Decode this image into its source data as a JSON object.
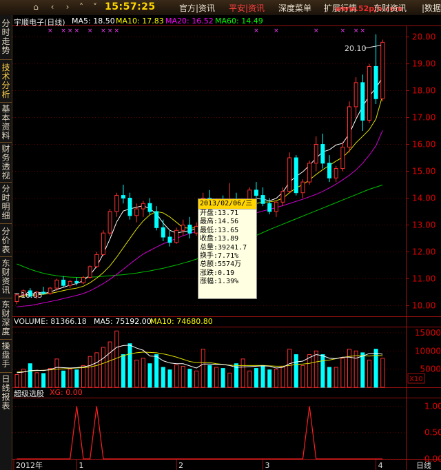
{
  "toolbar": {
    "home_icon": "home-icon",
    "clock": "15:57:25",
    "menus": [
      {
        "label": "官方|资讯",
        "active": false
      },
      {
        "label": "平安|资讯",
        "active": true
      },
      {
        "label": "深度菜单",
        "active": false
      },
      {
        "label": "扩展行情",
        "active": false
      },
      {
        "label": "东财资讯",
        "active": false
      },
      {
        "label": "|数据",
        "active": false
      }
    ],
    "watermark": "www.52pjb.com"
  },
  "sidebar": {
    "tabs": [
      {
        "label": "分时走势",
        "active": false
      },
      {
        "label": "技术分析",
        "active": true
      },
      {
        "label": "基本资料",
        "active": false
      },
      {
        "label": "财务透视",
        "active": false
      },
      {
        "label": "分时明细",
        "active": false
      },
      {
        "label": "分价表",
        "active": false
      },
      {
        "label": "东财资讯",
        "active": false
      },
      {
        "label": "东财深度",
        "active": false
      },
      {
        "label": "操盘手",
        "active": false
      },
      {
        "label": "日线报表",
        "active": false
      }
    ]
  },
  "kline_header": {
    "stock": "宇顺电子(日线)",
    "ma5": "MA5: 18.50",
    "ma10": "MA10: 17.83",
    "ma20": "MA20: 16.52",
    "ma60": "MA60: 14.49",
    "colors": {
      "ma5": "#ffffff",
      "ma10": "#ffff00",
      "ma20": "#ff00ff",
      "ma60": "#00ff00"
    }
  },
  "volume_header": {
    "volume": "VOLUME: 81366.18",
    "ma5": "MA5: 75192.00",
    "ma10": "MA10: 74680.80"
  },
  "indicator_header": {
    "name": "超级选股",
    "xg": "XG: 0.00"
  },
  "annotations": {
    "high": "20.10",
    "low": "10.05"
  },
  "axis": {
    "price_ticks": [
      "20.00",
      "19.00",
      "18.00",
      "17.00",
      "16.00",
      "15.00",
      "14.00",
      "13.00",
      "12.00",
      "11.00",
      "10.00"
    ],
    "volume_ticks": [
      "15000",
      "10000",
      "5000"
    ],
    "volume_unit": "X10",
    "indicator_ticks": [
      "1.00",
      "0.50",
      "0.00"
    ],
    "date_labels": [
      "2012年",
      "1",
      "2",
      "3",
      "4"
    ],
    "period": "日线"
  },
  "tooltip": {
    "date": "2013/02/06/三",
    "rows": [
      "开盘:13.71",
      "最高:14.56",
      "最低:13.65",
      "收盘:13.89",
      "总量:39241.7",
      "换手:7.71%",
      "总额:5574万",
      "涨跌:0.19",
      "涨幅:1.39%"
    ]
  },
  "chart_data": {
    "type": "candlestick",
    "price_range": [
      9.6,
      20.4
    ],
    "volume_range": [
      0,
      16500
    ],
    "indicator_range": [
      0,
      1.15
    ],
    "candles": [
      [
        10.15,
        10.45,
        10.05,
        10.4
      ],
      [
        10.4,
        10.6,
        10.3,
        10.55
      ],
      [
        10.55,
        10.65,
        10.3,
        10.35
      ],
      [
        10.35,
        10.55,
        10.25,
        10.5
      ],
      [
        10.5,
        10.7,
        10.4,
        10.45
      ],
      [
        10.45,
        10.7,
        10.4,
        10.65
      ],
      [
        10.65,
        11.0,
        10.55,
        10.95
      ],
      [
        10.95,
        11.1,
        10.7,
        10.75
      ],
      [
        10.75,
        10.95,
        10.65,
        10.9
      ],
      [
        10.9,
        11.05,
        10.75,
        10.85
      ],
      [
        10.85,
        11.1,
        10.8,
        11.05
      ],
      [
        11.05,
        11.5,
        11.0,
        11.45
      ],
      [
        11.45,
        12.0,
        11.4,
        11.9
      ],
      [
        11.9,
        12.8,
        11.85,
        12.7
      ],
      [
        12.7,
        13.6,
        12.6,
        13.5
      ],
      [
        13.5,
        14.2,
        13.3,
        14.1
      ],
      [
        14.1,
        14.5,
        13.8,
        14.0
      ],
      [
        14.0,
        14.2,
        13.2,
        13.35
      ],
      [
        13.35,
        13.8,
        13.1,
        13.6
      ],
      [
        13.6,
        13.9,
        13.3,
        13.8
      ],
      [
        13.8,
        14.0,
        13.4,
        13.5
      ],
      [
        13.5,
        13.7,
        12.8,
        12.9
      ],
      [
        12.9,
        13.2,
        12.4,
        12.55
      ],
      [
        12.55,
        12.8,
        12.2,
        12.35
      ],
      [
        12.35,
        12.9,
        12.3,
        12.8
      ],
      [
        12.8,
        13.2,
        12.6,
        13.0
      ],
      [
        13.0,
        13.3,
        12.5,
        12.7
      ],
      [
        12.7,
        13.1,
        12.6,
        12.95
      ],
      [
        12.95,
        14.2,
        12.9,
        14.0
      ],
      [
        14.0,
        14.3,
        13.5,
        13.7
      ],
      [
        13.7,
        14.0,
        13.4,
        13.85
      ],
      [
        13.85,
        14.1,
        13.6,
        13.7
      ],
      [
        13.71,
        14.56,
        13.65,
        13.89
      ],
      [
        13.89,
        14.2,
        13.5,
        13.6
      ],
      [
        13.6,
        14.0,
        13.4,
        13.9
      ],
      [
        13.9,
        14.4,
        13.8,
        14.3
      ],
      [
        14.3,
        14.6,
        14.0,
        14.1
      ],
      [
        14.1,
        14.4,
        13.7,
        13.8
      ],
      [
        13.8,
        14.0,
        13.4,
        13.5
      ],
      [
        13.5,
        13.9,
        13.3,
        13.85
      ],
      [
        13.85,
        14.4,
        13.7,
        14.25
      ],
      [
        14.25,
        15.7,
        14.2,
        15.5
      ],
      [
        15.5,
        15.6,
        14.1,
        14.2
      ],
      [
        14.2,
        14.7,
        14.0,
        14.6
      ],
      [
        14.6,
        15.4,
        14.5,
        15.3
      ],
      [
        15.3,
        16.3,
        15.0,
        16.0
      ],
      [
        16.0,
        16.4,
        15.1,
        15.3
      ],
      [
        15.3,
        15.6,
        14.6,
        14.75
      ],
      [
        14.75,
        15.2,
        14.6,
        15.1
      ],
      [
        15.1,
        16.1,
        15.0,
        15.9
      ],
      [
        15.9,
        17.6,
        15.7,
        17.4
      ],
      [
        17.4,
        18.5,
        17.0,
        18.3
      ],
      [
        18.3,
        18.6,
        16.5,
        16.9
      ],
      [
        16.9,
        19.0,
        16.8,
        18.9
      ],
      [
        18.9,
        20.1,
        17.5,
        17.7
      ],
      [
        17.7,
        19.9,
        17.6,
        19.8
      ]
    ],
    "volume": [
      3500,
      5000,
      6500,
      4000,
      3800,
      5200,
      7800,
      4500,
      5000,
      4800,
      6000,
      8500,
      9500,
      11000,
      12500,
      15500,
      9000,
      12000,
      7500,
      8000,
      6500,
      9000,
      5500,
      4800,
      6200,
      5800,
      5000,
      4500,
      10500,
      6000,
      5500,
      5200,
      3924,
      6500,
      7800,
      4500,
      5200,
      6000,
      4800,
      5000,
      5800,
      10500,
      9000,
      6000,
      9000,
      10000,
      9000,
      5500,
      5500,
      8000,
      10500,
      10000,
      9500,
      7500,
      10500,
      8000
    ],
    "ma5": [
      10.3,
      10.4,
      10.42,
      10.45,
      10.45,
      10.5,
      10.6,
      10.68,
      10.76,
      10.82,
      10.93,
      11.14,
      11.46,
      11.93,
      12.48,
      13.11,
      13.52,
      13.6,
      13.66,
      13.72,
      13.6,
      13.42,
      13.07,
      12.8,
      12.7,
      12.75,
      12.79,
      12.85,
      13.16,
      13.32,
      13.48,
      13.69,
      13.83,
      13.74,
      13.8,
      13.91,
      13.98,
      13.96,
      13.9,
      13.99,
      14.22,
      14.6,
      14.81,
      14.98,
      15.22,
      15.49,
      15.72,
      15.8,
      15.98,
      16.04,
      16.4,
      16.94,
      17.42,
      17.8,
      18.1,
      18.5
    ],
    "ma10": [
      10.3,
      10.35,
      10.38,
      10.4,
      10.42,
      10.45,
      10.5,
      10.56,
      10.61,
      10.65,
      10.72,
      10.85,
      11.02,
      11.23,
      11.48,
      11.8,
      12.15,
      12.5,
      12.85,
      13.15,
      13.38,
      13.5,
      13.45,
      13.3,
      13.1,
      12.9,
      12.88,
      12.9,
      12.95,
      13.0,
      13.1,
      13.3,
      13.45,
      13.55,
      13.64,
      13.75,
      13.8,
      13.85,
      13.86,
      13.9,
      14.0,
      14.2,
      14.38,
      14.5,
      14.68,
      14.88,
      15.06,
      15.22,
      15.38,
      15.52,
      15.76,
      16.06,
      16.3,
      16.55,
      16.95,
      17.83
    ],
    "ma20": [
      9.95,
      9.98,
      10.0,
      10.05,
      10.1,
      10.15,
      10.2,
      10.26,
      10.32,
      10.38,
      10.45,
      10.55,
      10.68,
      10.82,
      10.98,
      11.16,
      11.35,
      11.55,
      11.74,
      11.92,
      12.05,
      12.18,
      12.3,
      12.4,
      12.5,
      12.6,
      12.68,
      12.76,
      12.84,
      12.92,
      13.0,
      13.08,
      13.15,
      13.22,
      13.3,
      13.38,
      13.45,
      13.52,
      13.58,
      13.65,
      13.72,
      13.8,
      13.88,
      13.96,
      14.05,
      14.14,
      14.25,
      14.38,
      14.52,
      14.68,
      14.85,
      15.05,
      15.3,
      15.6,
      15.95,
      16.52
    ],
    "ma60": [
      11.55,
      11.45,
      11.35,
      11.27,
      11.2,
      11.15,
      11.11,
      11.08,
      11.06,
      11.05,
      11.05,
      11.06,
      11.07,
      11.09,
      11.11,
      11.13,
      11.15,
      11.18,
      11.21,
      11.25,
      11.29,
      11.34,
      11.39,
      11.45,
      11.51,
      11.58,
      11.65,
      11.73,
      11.81,
      11.9,
      11.99,
      12.08,
      12.18,
      12.28,
      12.39,
      12.5,
      12.61,
      12.72,
      12.83,
      12.93,
      13.03,
      13.13,
      13.23,
      13.33,
      13.43,
      13.53,
      13.63,
      13.73,
      13.83,
      13.93,
      14.03,
      14.13,
      14.23,
      14.33,
      14.41,
      14.49
    ],
    "vol_ma5": [
      4000,
      4200,
      4600,
      4700,
      4600,
      4900,
      5500,
      5400,
      5300,
      5400,
      5600,
      6000,
      6800,
      8000,
      9500,
      11000,
      11500,
      11600,
      10800,
      10200,
      8600,
      8500,
      7300,
      6700,
      6500,
      6500,
      5900,
      5300,
      6400,
      6400,
      6300,
      6300,
      6000,
      5500,
      5600,
      5700,
      5800,
      5900,
      5800,
      5300,
      5500,
      6500,
      7000,
      7200,
      8200,
      9000,
      8700,
      8000,
      7900,
      8300,
      8300,
      8000,
      8600,
      9300,
      9400,
      9100
    ],
    "vol_ma10": [
      4200,
      4300,
      4500,
      4600,
      4700,
      4800,
      5000,
      5100,
      5200,
      5300,
      5400,
      5600,
      6000,
      6600,
      7300,
      8000,
      8700,
      9200,
      9500,
      9700,
      9600,
      9500,
      9200,
      8800,
      8300,
      7700,
      7100,
      6800,
      6900,
      6800,
      6500,
      6300,
      6100,
      6000,
      6000,
      6000,
      6000,
      6000,
      5900,
      5800,
      5800,
      6000,
      6300,
      6400,
      6600,
      7000,
      7300,
      7500,
      7900,
      8200,
      8500,
      8700,
      8700,
      8600,
      8800,
      8700
    ],
    "xg_signals": [
      9,
      12,
      44
    ],
    "markers": [
      5,
      7,
      8,
      9,
      11,
      13,
      14,
      15,
      36,
      39,
      45,
      49,
      51,
      52
    ]
  }
}
